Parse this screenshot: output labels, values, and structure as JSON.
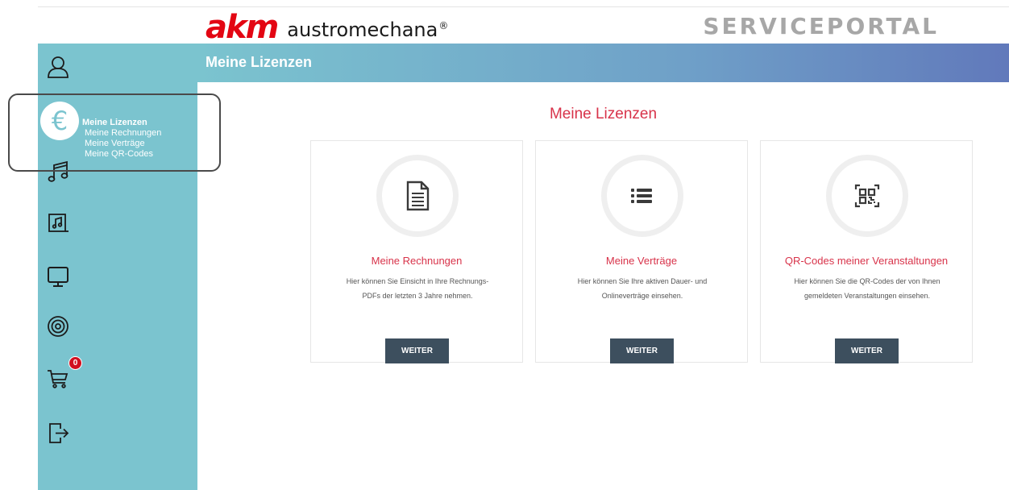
{
  "header": {
    "logo_mark": "akm",
    "logo_word": "austromechana",
    "logo_reg": "®",
    "portal_title": "SERVICEPORTAL"
  },
  "sidebar": {
    "icons": [
      "user-icon",
      "euro-icon",
      "music-note-icon",
      "music-sheet-icon",
      "monitor-icon",
      "disc-icon",
      "cart-icon",
      "logout-icon"
    ],
    "euro_symbol": "€",
    "active_menu": {
      "label": "Meine Lizenzen",
      "items": [
        "Meine Rechnungen",
        "Meine Verträge",
        "Meine QR-Codes"
      ]
    },
    "cart_count": "0"
  },
  "banner": {
    "title": "Meine Lizenzen"
  },
  "main": {
    "title": "Meine Lizenzen",
    "cards": [
      {
        "icon": "document-icon",
        "title": "Meine Rechnungen",
        "desc_line1": "Hier können Sie Einsicht in Ihre Rechnungs-",
        "desc_line2": "PDFs der letzten 3 Jahre nehmen.",
        "button": "WEITER"
      },
      {
        "icon": "list-icon",
        "title": "Meine Verträge",
        "desc_line1": "Hier können Sie Ihre aktiven Dauer- und",
        "desc_line2": "Onlineverträge einsehen.",
        "button": "WEITER"
      },
      {
        "icon": "qr-code-icon",
        "title": "QR-Codes meiner Veranstaltungen",
        "desc_line1": "Hier können Sie die QR-Codes der von Ihnen",
        "desc_line2": "gemeldeten Veranstaltungen einsehen.",
        "button": "WEITER"
      }
    ]
  },
  "colors": {
    "brand_red": "#e30613",
    "sidebar": "#7bc4cf",
    "accent_text": "#d8334a",
    "button": "#3d4f5e"
  }
}
